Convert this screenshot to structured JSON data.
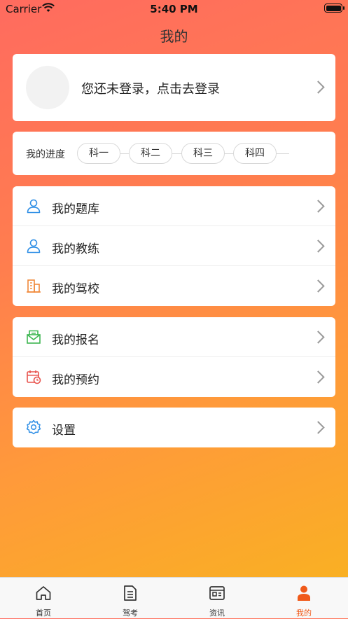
{
  "status_bar": {
    "carrier": "Carrier",
    "time": "5:40 PM"
  },
  "page_title": "我的",
  "login": {
    "prompt": "您还未登录，点击去登录"
  },
  "progress": {
    "label": "我的进度",
    "steps": [
      "科一",
      "科二",
      "科三",
      "科四"
    ]
  },
  "menu_group_1": [
    {
      "label": "我的题库",
      "icon": "user-outline-icon",
      "color": "#2f8fe6"
    },
    {
      "label": "我的教练",
      "icon": "user-outline-icon",
      "color": "#2f8fe6"
    },
    {
      "label": "我的驾校",
      "icon": "building-icon",
      "color": "#f0893a"
    }
  ],
  "menu_group_2": [
    {
      "label": "我的报名",
      "icon": "envelope-icon",
      "color": "#3cb650"
    },
    {
      "label": "我的预约",
      "icon": "calendar-clock-icon",
      "color": "#e8534d"
    }
  ],
  "menu_group_3": [
    {
      "label": "设置",
      "icon": "gear-icon",
      "color": "#2f8fe6"
    }
  ],
  "tabbar": {
    "items": [
      {
        "label": "首页",
        "icon": "home-icon"
      },
      {
        "label": "驾考",
        "icon": "document-icon"
      },
      {
        "label": "资讯",
        "icon": "news-icon"
      },
      {
        "label": "我的",
        "icon": "person-filled-icon"
      }
    ],
    "active": "我的",
    "active_color": "#f05a1a"
  }
}
